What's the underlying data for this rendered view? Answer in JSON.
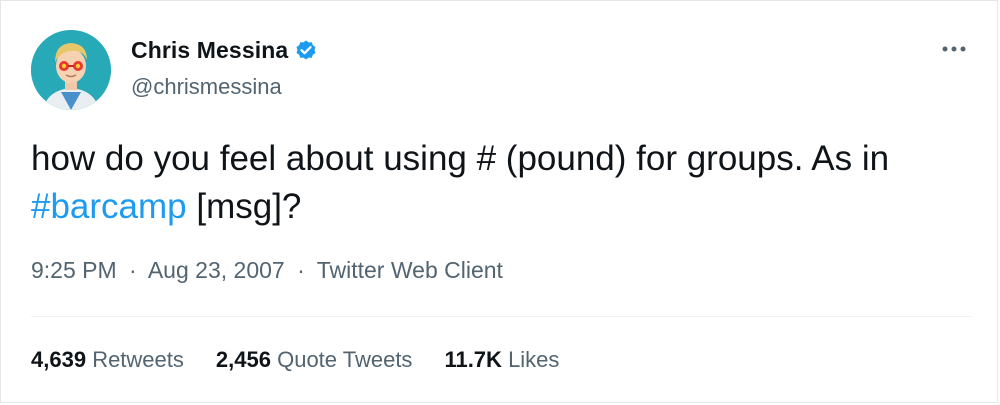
{
  "author": {
    "display_name": "Chris Messina",
    "handle": "@chrismessina",
    "avatar_icon": "cartoon-avatar-icon",
    "verified_icon": "verified-badge-icon"
  },
  "menu_icon": "more-options-icon",
  "tweet": {
    "text_part1": "how do you feel about using # (pound) for groups. As in ",
    "hashtag": "#barcamp",
    "text_part2": " [msg]?"
  },
  "meta": {
    "time": "9:25 PM",
    "separator": "·",
    "date": "Aug 23, 2007",
    "source": "Twitter Web Client"
  },
  "stats": {
    "retweets_count": "4,639",
    "retweets_label": "Retweets",
    "quotes_count": "2,456",
    "quotes_label": "Quote Tweets",
    "likes_count": "11.7K",
    "likes_label": "Likes"
  },
  "colors": {
    "text": "#0f1419",
    "secondary": "#536471",
    "accent": "#1d9bf0",
    "avatar_bg": "#27a9b8"
  }
}
